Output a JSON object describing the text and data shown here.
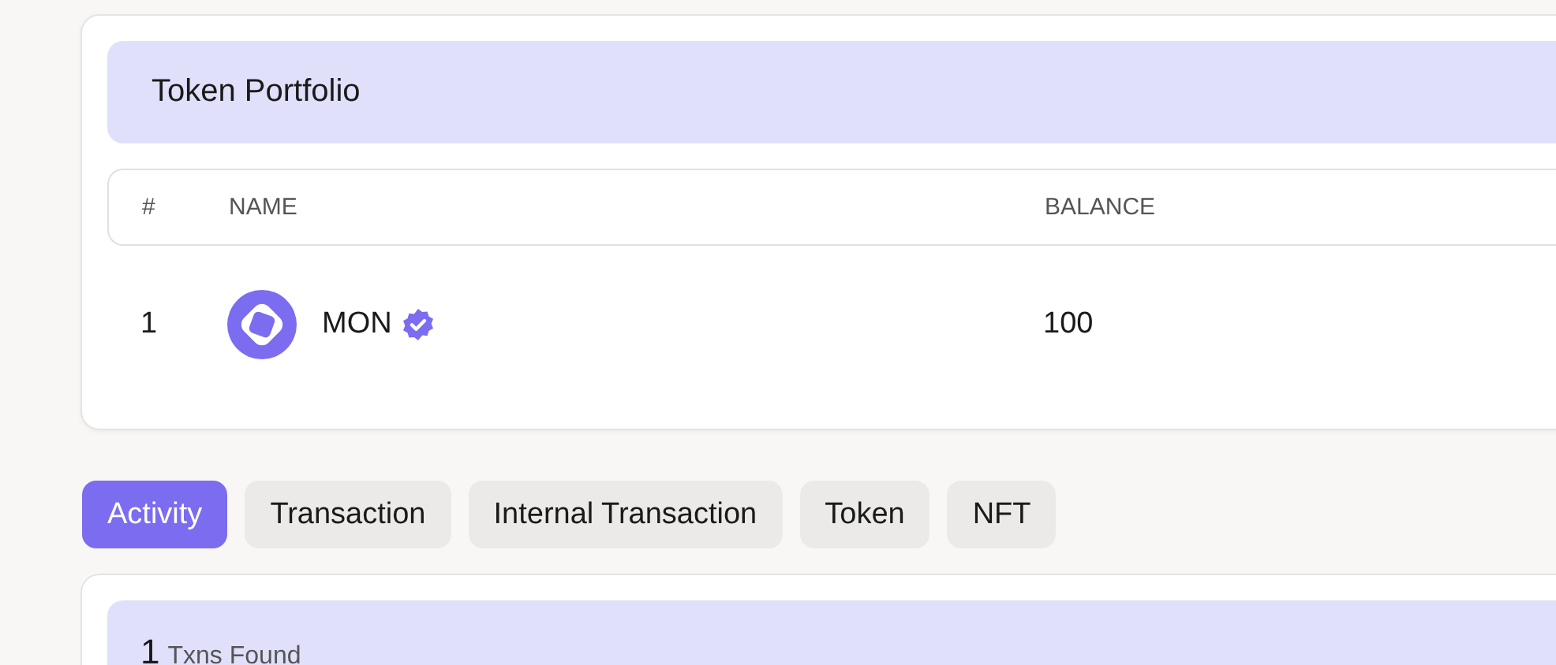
{
  "portfolio": {
    "title": "Token Portfolio",
    "columns": [
      "#",
      "NAME",
      "BALANCE"
    ],
    "rows": [
      {
        "index": "1",
        "name": "MON",
        "verified": true,
        "balance": "100"
      }
    ]
  },
  "tabs": [
    {
      "label": "Activity",
      "selected": true
    },
    {
      "label": "Transaction",
      "selected": false
    },
    {
      "label": "Internal Transaction",
      "selected": false
    },
    {
      "label": "Token",
      "selected": false
    },
    {
      "label": "NFT",
      "selected": false
    }
  ],
  "activity": {
    "count": "1",
    "count_label": "Txns Found"
  }
}
